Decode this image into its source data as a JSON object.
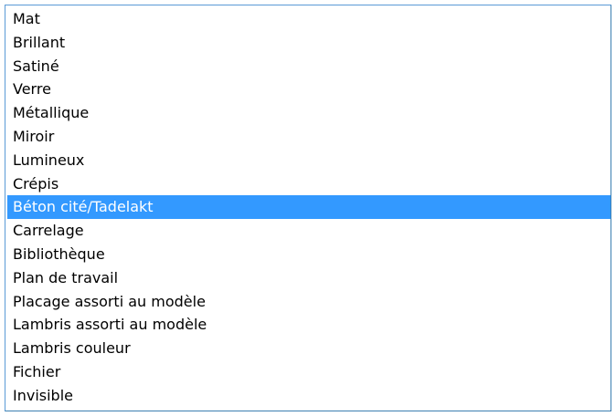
{
  "listbox": {
    "items": [
      {
        "label": "Mat",
        "selected": false
      },
      {
        "label": "Brillant",
        "selected": false
      },
      {
        "label": "Satiné",
        "selected": false
      },
      {
        "label": "Verre",
        "selected": false
      },
      {
        "label": "Métallique",
        "selected": false
      },
      {
        "label": "Miroir",
        "selected": false
      },
      {
        "label": "Lumineux",
        "selected": false
      },
      {
        "label": "Crépis",
        "selected": false
      },
      {
        "label": "Béton cité/Tadelakt",
        "selected": true
      },
      {
        "label": "Carrelage",
        "selected": false
      },
      {
        "label": "Bibliothèque",
        "selected": false
      },
      {
        "label": "Plan de travail",
        "selected": false
      },
      {
        "label": "Placage assorti au modèle",
        "selected": false
      },
      {
        "label": "Lambris assorti au modèle",
        "selected": false
      },
      {
        "label": "Lambris couleur",
        "selected": false
      },
      {
        "label": "Fichier",
        "selected": false
      },
      {
        "label": "Invisible",
        "selected": false
      }
    ]
  },
  "colors": {
    "selection_background": "#3399ff",
    "selection_text": "#ffffff",
    "border": "#5a9ad6"
  }
}
